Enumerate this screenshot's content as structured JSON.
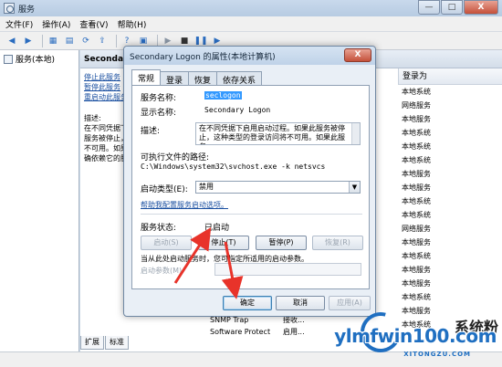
{
  "window": {
    "title": "服务",
    "controls": [
      "—",
      "□",
      "X"
    ]
  },
  "menu": [
    "文件(F)",
    "操作(A)",
    "查看(V)",
    "帮助(H)"
  ],
  "tree": {
    "root": "服务(本地)"
  },
  "content": {
    "header": "Secondary",
    "links": [
      "停止此服务",
      "暂停此服务",
      "重启动此服务"
    ],
    "desc_title": "描述:",
    "desc_lines": [
      "在不同凭据下",
      "服务被停止，",
      "不可用。如果",
      "确依赖它的服"
    ],
    "logon_header": "登录为",
    "logon_values": [
      "本地系统",
      "网络服务",
      "本地服务",
      "本地系统",
      "本地系统",
      "本地系统",
      "本地服务",
      "本地服务",
      "本地系统",
      "本地系统",
      "网络服务",
      "本地服务",
      "本地系统",
      "本地服务",
      "本地服务",
      "本地系统",
      "本地服务",
      "本地系统"
    ],
    "bg_rows": [
      {
        "name": "SNMP Trap",
        "value": "接收..."
      },
      {
        "name": "Software Protect",
        "value": "启用..."
      }
    ],
    "tabs": [
      "扩展",
      "标准"
    ]
  },
  "dialog": {
    "title": "Secondary Logon 的属性(本地计算机)",
    "close": "X",
    "tabs": [
      "常规",
      "登录",
      "恢复",
      "依存关系"
    ],
    "service_name_label": "服务名称:",
    "service_name": "seclogon",
    "display_name_label": "显示名称:",
    "display_name": "Secondary Logon",
    "description_label": "描述:",
    "description": "在不同凭据下启用启动过程。如果此服务被停止，这种类型的登录访问将不可用。如果此服务",
    "exe_path_label": "可执行文件的路径:",
    "exe_path": "C:\\Windows\\system32\\svchost.exe -k netsvcs",
    "startup_type_label": "启动类型(E):",
    "startup_type": "禁用",
    "help_link": "帮助我配置服务启动选项。",
    "status_label": "服务状态:",
    "status": "已启动",
    "buttons": {
      "start": "启动(S)",
      "stop": "停止(T)",
      "pause": "暂停(P)",
      "resume": "恢复(R)"
    },
    "hint": "当从此处启动服务时，您可指定所适用的启动参数。",
    "params_label": "启动参数(M):",
    "ok": "确定",
    "cancel": "取消",
    "apply": "应用(A)"
  },
  "watermark": {
    "text": "ylmfwin100.com",
    "cn": "系统粉",
    "sub": "XITONGZU.COM"
  },
  "colors": {
    "arrow": "#e8332a",
    "link": "#1a4fa0",
    "selection": "#3399ff"
  }
}
